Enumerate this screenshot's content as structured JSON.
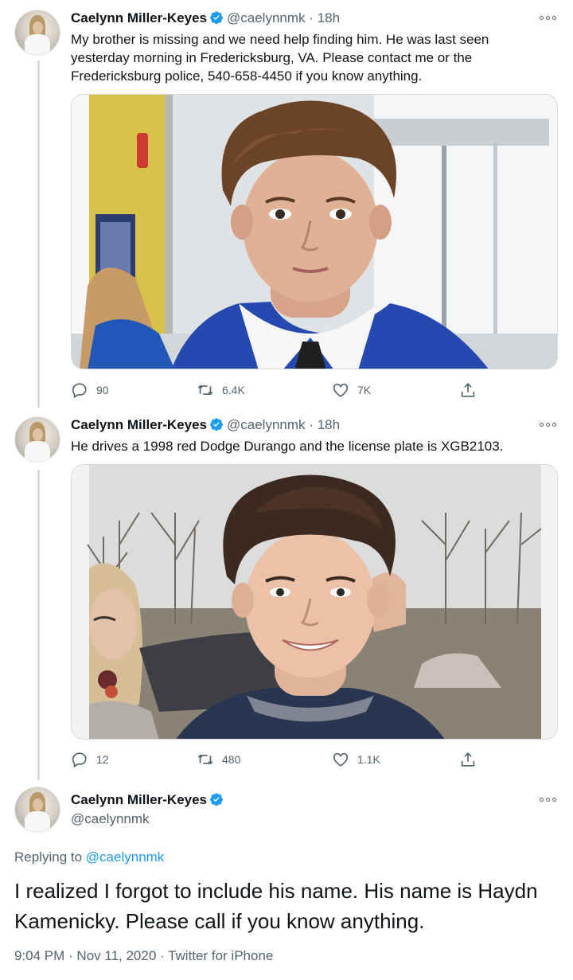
{
  "author": {
    "name": "Caelynn Miller-Keyes",
    "handle": "@caelynnmk",
    "separator": "·"
  },
  "tweets": [
    {
      "time": "18h",
      "text": "My brother is missing and we need help finding him. He was last seen yesterday morning in Fredericksburg, VA. Please contact me or the Fredericksburg police, 540-658-4450 if you know anything.",
      "media_icon": "photo-young-man-blue-sweater-indoors",
      "stats": {
        "replies": "90",
        "retweets": "6.4K",
        "likes": "7K"
      }
    },
    {
      "time": "18h",
      "text": "He drives a 1998 red Dodge Durango and the license plate is XGB2103.",
      "media_icon": "photo-young-man-smiling-outdoors",
      "stats": {
        "replies": "12",
        "retweets": "480",
        "likes": "1.1K"
      }
    }
  ],
  "main_tweet": {
    "replying_prefix": "Replying to",
    "replying_to": "@caelynnmk",
    "text": "I realized I forgot to include his name. His name is Haydn Kamenicky. Please call if you know anything.",
    "timestamp": "9:04 PM · Nov 11, 2020 · Twitter for iPhone"
  },
  "colors": {
    "accent": "#1d9bf0",
    "secondary_text": "#536471",
    "border": "#cfd9de"
  }
}
